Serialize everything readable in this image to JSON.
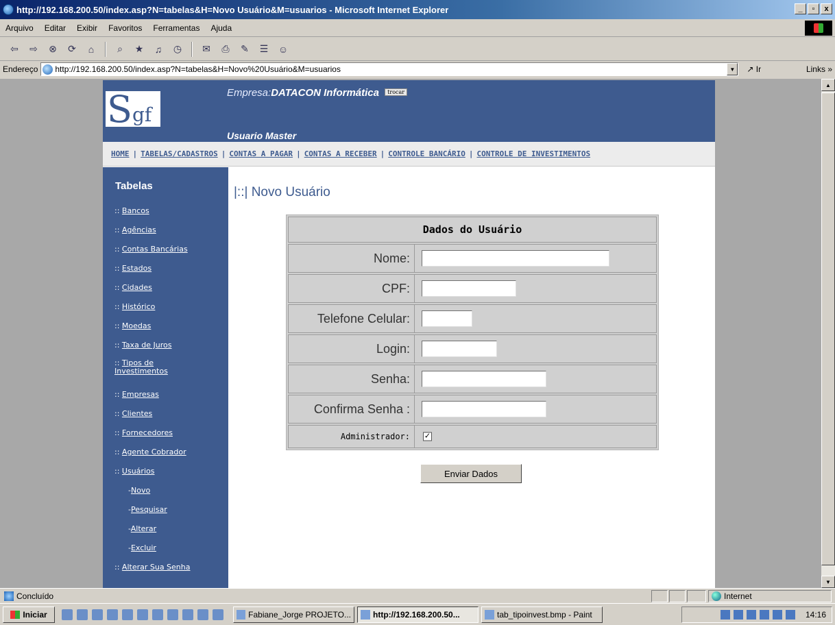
{
  "window": {
    "title": "http://192.168.200.50/index.asp?N=tabelas&H=Novo Usuário&M=usuarios - Microsoft Internet Explorer",
    "min": "_",
    "max": "▫",
    "close": "x"
  },
  "menu": [
    "Arquivo",
    "Editar",
    "Exibir",
    "Favoritos",
    "Ferramentas",
    "Ajuda"
  ],
  "toolbar_icons": [
    "back-icon",
    "forward-icon",
    "stop-icon",
    "refresh-icon",
    "home-icon",
    "search-icon",
    "favorites-icon",
    "media-icon",
    "history-icon",
    "mail-icon",
    "print-icon",
    "edit-icon",
    "discuss-icon",
    "messenger-icon"
  ],
  "address": {
    "label": "Endereço",
    "url": "http://192.168.200.50/index.asp?N=tabelas&H=Novo%20Usuário&M=usuarios",
    "go": "Ir",
    "links": "Links"
  },
  "page": {
    "logo_s": "S",
    "logo_gf": "gf",
    "empresa_prefix": "Empresa:",
    "empresa_name": "DATACON Informática",
    "trocar": "trocar",
    "usuario": "Usuario Master",
    "nav": [
      "HOME",
      "TABELAS/CADASTROS",
      "CONTAS A PAGAR",
      "CONTAS A RECEBER",
      "CONTROLE BANCÁRIO",
      "CONTROLE DE INVESTIMENTOS"
    ],
    "sidebar_title": "Tabelas",
    "sidebar": [
      {
        "prefix": ":: ",
        "label": "Bancos"
      },
      {
        "prefix": ":: ",
        "label": "Agências"
      },
      {
        "prefix": ":: ",
        "label": "Contas Bancárias"
      },
      {
        "prefix": ":: ",
        "label": "Estados"
      },
      {
        "prefix": ":: ",
        "label": "Cidades"
      },
      {
        "prefix": ":: ",
        "label": "Histórico"
      },
      {
        "prefix": ":: ",
        "label": "Moedas"
      },
      {
        "prefix": ":: ",
        "label": "Taxa de Juros"
      },
      {
        "prefix": ":: ",
        "label": "Tipos de"
      },
      {
        "prefix": "",
        "label": "Investimentos"
      },
      {
        "prefix": ":: ",
        "label": "Empresas"
      },
      {
        "prefix": ":: ",
        "label": "Clientes"
      },
      {
        "prefix": ":: ",
        "label": "Fornecedores"
      },
      {
        "prefix": ":: ",
        "label": "Agente Cobrador"
      },
      {
        "prefix": ":: ",
        "label": "Usuários"
      },
      {
        "prefix": "-",
        "label": "Novo"
      },
      {
        "prefix": "-",
        "label": "Pesquisar"
      },
      {
        "prefix": "-",
        "label": "Alterar"
      },
      {
        "prefix": "-",
        "label": "Excluir"
      },
      {
        "prefix": ":: ",
        "label": "Alterar Sua Senha"
      }
    ],
    "title": "|::| Novo Usuário",
    "form": {
      "heading": "Dados do Usuário",
      "fields": [
        {
          "label": "Nome:",
          "value": ""
        },
        {
          "label": "CPF:",
          "value": ""
        },
        {
          "label": "Telefone Celular:",
          "value": ""
        },
        {
          "label": "Login:",
          "value": ""
        },
        {
          "label": "Senha:",
          "value": ""
        },
        {
          "label": "Confirma Senha :",
          "value": ""
        }
      ],
      "admin_label": "Administrador:",
      "admin_checked": "✓",
      "submit": "Enviar Dados"
    }
  },
  "status": {
    "text": "Concluído",
    "zone": "Internet"
  },
  "taskbar": {
    "start": "Iniciar",
    "tasks": [
      "Fabiane_Jorge PROJETO...",
      "http://192.168.200.50...",
      "tab_tipoinvest.bmp - Paint"
    ],
    "clock": "14:16"
  }
}
